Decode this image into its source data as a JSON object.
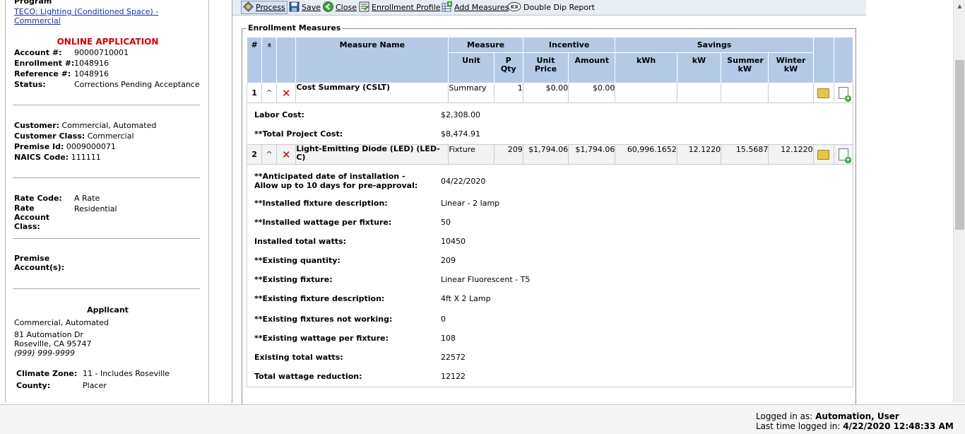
{
  "sidebar": {
    "program_label": "Program",
    "program_link": "TECO: Lighting (Conditioned Space) - Commercial",
    "online_application": "ONLINE APPLICATION",
    "account": {
      "label": "Account #:",
      "value": "90000710001"
    },
    "enrollment": {
      "label": "Enrollment #:",
      "value": "1048916"
    },
    "reference": {
      "label": "Reference #:",
      "value": "1048916"
    },
    "status": {
      "label": "Status:",
      "value": "Corrections Pending Acceptance"
    },
    "customer": {
      "label": "Customer:",
      "value": "Commercial, Automated"
    },
    "customer_class": {
      "label": "Customer Class:",
      "value": "Commercial"
    },
    "premise_id": {
      "label": "Premise Id:",
      "value": "0009000071"
    },
    "naics": {
      "label": "NAICS Code:",
      "value": "111111"
    },
    "rate_code": {
      "label": "Rate Code:",
      "value": "A Rate"
    },
    "rate_account_class": {
      "label": "Rate Account Class:",
      "value": "Residential"
    },
    "premise_accounts": {
      "label": "Premise Account(s):"
    },
    "applicant": {
      "title": "Applicant",
      "name": "Commercial, Automated",
      "address1": "81 Automation Dr",
      "address2": "Roseville, CA 95747",
      "phone": "(999) 999-9999"
    },
    "climate_zone": {
      "label": "Climate Zone:",
      "value": "11 - Includes Roseville"
    },
    "county": {
      "label": "County:",
      "value": "Placer"
    }
  },
  "toolbar": {
    "process": "Process",
    "save": "Save",
    "close": "Close",
    "enrollment_profile": "Enrollment Profile",
    "add_measures": "Add Measures",
    "double_dip": "Double Dip Report"
  },
  "measures": {
    "legend": "Enrollment Measures",
    "headers": {
      "hash": "#",
      "sort": "»",
      "measure_name": "Measure Name",
      "measure": "Measure",
      "incentive": "Incentive",
      "savings": "Savings",
      "unit": "Unit",
      "p_qty": "P Qty",
      "unit_price": "Unit Price",
      "amount": "Amount",
      "kwh": "kWh",
      "kw": "kW",
      "summer_kw": "Summer kW",
      "winter_kw": "Winter kW"
    },
    "rows": [
      {
        "num": "1",
        "name": "Cost Summary (CSLT)",
        "unit": "Summary",
        "qty": "1",
        "unit_price": "$0.00",
        "amount": "$0.00",
        "kwh": "",
        "kw": "",
        "summer_kw": "",
        "winter_kw": "",
        "details": [
          {
            "label": "Labor Cost:",
            "value": "$2,308.00"
          },
          {
            "label": "**Total Project Cost:",
            "value": "$8,474.91"
          }
        ]
      },
      {
        "num": "2",
        "name": "Light-Emitting Diode (LED) (LED-C)",
        "unit": "Fixture",
        "qty": "209",
        "unit_price": "$1,794.06",
        "amount": "$1,794.06",
        "kwh": "60,996.1652",
        "kw": "12.1220",
        "summer_kw": "15.5687",
        "winter_kw": "12.1220",
        "details": [
          {
            "label": "**Anticipated date of installation - Allow up to 10 days for pre-approval:",
            "value": "04/22/2020"
          },
          {
            "label": "**Installed fixture description:",
            "value": "Linear - 2 lamp"
          },
          {
            "label": "**Installed wattage per fixture:",
            "value": "50"
          },
          {
            "label": "Installed total watts:",
            "value": "10450"
          },
          {
            "label": "**Existing quantity:",
            "value": "209"
          },
          {
            "label": "**Existing fixture:",
            "value": "Linear Fluorescent - T5"
          },
          {
            "label": "**Existing fixture description:",
            "value": "4ft X 2 Lamp"
          },
          {
            "label": "**Existing fixtures not working:",
            "value": "0"
          },
          {
            "label": "**Existing wattage per fixture:",
            "value": "108"
          },
          {
            "label": "Existing total watts:",
            "value": "22572"
          },
          {
            "label": "Total wattage reduction:",
            "value": "12122"
          }
        ]
      }
    ]
  },
  "footer": {
    "logged_in_label": "Logged in as:",
    "logged_in_user": "Automation, User",
    "last_login_label": "Last time logged in:",
    "last_login_value": "4/22/2020 12:48:33 AM"
  },
  "colors": {
    "header_blue": "#b4c9e6",
    "alert_red": "#d40000",
    "link_blue": "#1a2fa6"
  }
}
